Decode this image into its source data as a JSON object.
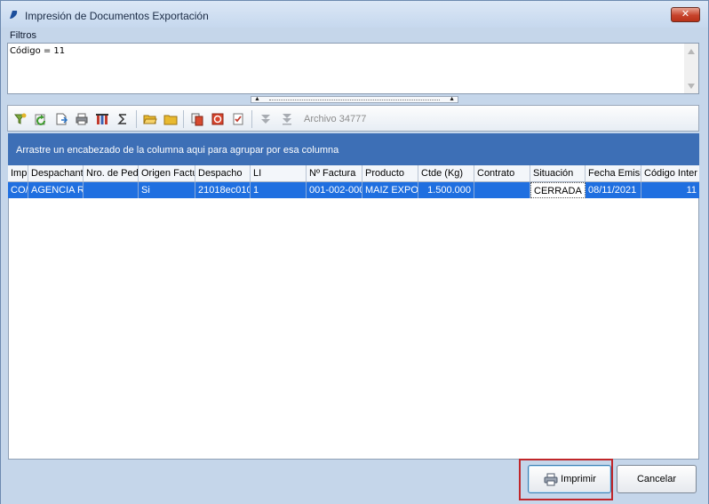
{
  "window": {
    "title": "Impresión de Documentos Exportación",
    "close_label": "✕"
  },
  "filters": {
    "label": "Filtros",
    "text": "Código = 11"
  },
  "toolbar": {
    "archive_label": "Archivo 34777"
  },
  "grid": {
    "group_prompt": "Arrastre un encabezado de la columna aqui para agrupar por esa columna",
    "columns": [
      "Imp",
      "Despachant",
      "Nro. de Ped",
      "Origen Factu",
      "Despacho",
      "LI",
      "Nº Factura",
      "Producto",
      "Ctde (Kg)",
      "Contrato",
      "Situación",
      "Fecha Emisi",
      "Código Inter"
    ],
    "row": [
      "CO/",
      "AGENCIA R\\",
      "",
      "Si",
      "21018ec010",
      "1",
      "001-002-000",
      "MAIZ EXPOR",
      "1.500.000",
      "",
      "CERRADA",
      "08/11/2021",
      "11"
    ]
  },
  "footer": {
    "print_label": "Imprimir",
    "cancel_label": "Cancelar"
  }
}
